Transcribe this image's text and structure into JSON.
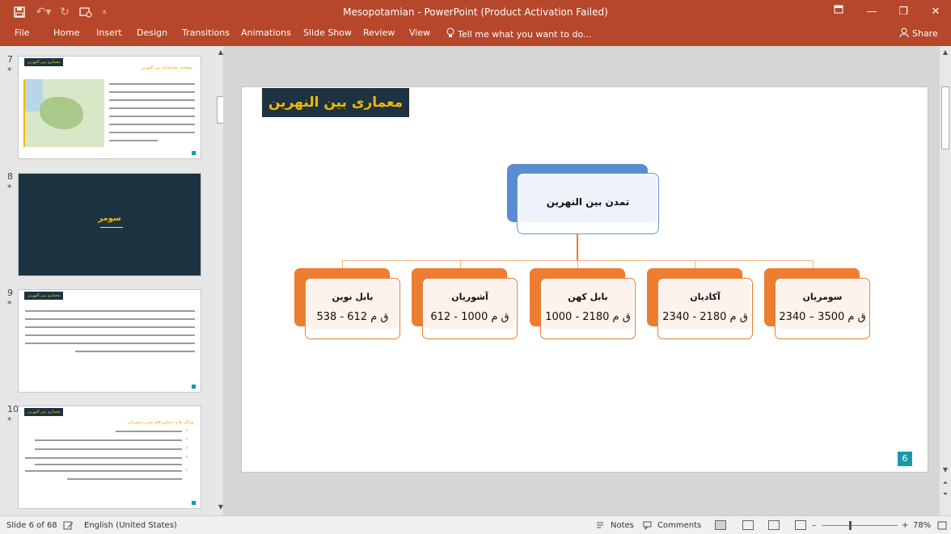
{
  "app": {
    "window_title": "Mesopotamian - PowerPoint (Product Activation Failed)"
  },
  "ribbon": {
    "tabs": [
      "File",
      "Home",
      "Insert",
      "Design",
      "Transitions",
      "Animations",
      "Slide Show",
      "Review",
      "View"
    ],
    "tell_me": "Tell me what you want to do...",
    "share": "Share"
  },
  "thumbnails": [
    {
      "number": "7",
      "title_tag": "معماری بین النهرین",
      "heading": "موقعیت جغرافیایی بین النهرین"
    },
    {
      "number": "8",
      "title_text": "سومر"
    },
    {
      "number": "9",
      "title_tag": "معماری بین النهرین"
    },
    {
      "number": "10",
      "title_tag": "معماری بین النهرین",
      "heading": "ویژگی ها و دستاوردهای تمدن سومریان"
    }
  ],
  "slide": {
    "title": "معماری بین النهرین",
    "page_number": "6",
    "root": {
      "label": "تمدن بین النهرین"
    },
    "children": [
      {
        "name": "بابل نوین",
        "date": "ق م  612 - 538"
      },
      {
        "name": "آشوریان",
        "date": "ق م  1000 - 612"
      },
      {
        "name": "بابل کهن",
        "date": "ق م  2180 - 1000"
      },
      {
        "name": "آکادیان",
        "date": "ق م  2180 - 2340"
      },
      {
        "name": "سومریان",
        "date": "ق م  3500 – 2340"
      }
    ]
  },
  "status": {
    "slide_info": "Slide 6 of 68",
    "language": "English (United States)",
    "notes": "Notes",
    "comments": "Comments",
    "zoom": "78%"
  },
  "colors": {
    "accent": "#b7472a",
    "title_bg": "#1e3341",
    "title_text": "#f0b800",
    "root_blue": "#5b8bd0",
    "child_orange": "#ed7d31",
    "page_badge": "#1a9aa8"
  }
}
